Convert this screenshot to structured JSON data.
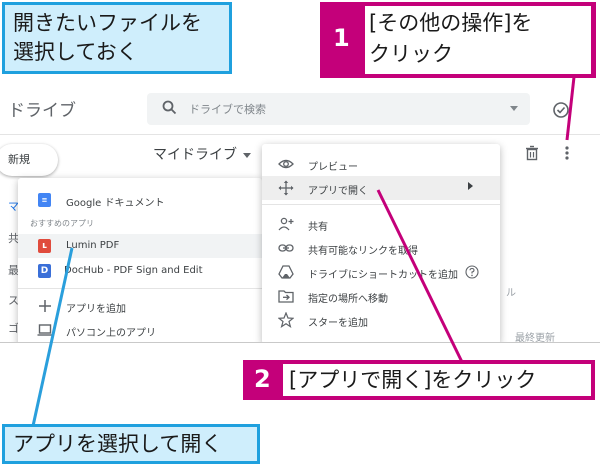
{
  "callouts": {
    "select_file": {
      "line1": "開きたいファイルを",
      "line2": "選択しておく"
    },
    "step1": {
      "number": "1",
      "line1": "[その他の操作]を",
      "line2": "クリック"
    },
    "step2": {
      "number": "2",
      "text": "[アプリで開く]をクリック"
    },
    "select_app": {
      "text": "アプリを選択して開く"
    }
  },
  "drive": {
    "title": "ドライブ",
    "search_placeholder": "ドライブで検索",
    "new_button": "新規",
    "breadcrumb": "マイドライブ"
  },
  "sidebar_peek": [
    "マ",
    "共",
    "最",
    "ス",
    "ゴ"
  ],
  "background_peek": {
    "ru": "ル",
    "last_modified": "最終更新"
  },
  "apps_menu": {
    "items_top": [
      {
        "label": "Google ドキュメント",
        "icon": "google-docs-icon"
      }
    ],
    "suggested_heading": "おすすめのアプリ",
    "suggested": [
      {
        "label": "Lumin PDF",
        "icon": "lumin-pdf-icon",
        "color": "#e04b3c",
        "selected": true
      },
      {
        "label": "DocHub - PDF Sign and Edit",
        "icon": "dochub-icon",
        "color": "#3a6fd8"
      }
    ],
    "actions": [
      {
        "label": "アプリを追加",
        "icon": "plus-icon"
      },
      {
        "label": "パソコン上のアプリ",
        "icon": "laptop-icon"
      }
    ]
  },
  "context_menu": {
    "items": [
      {
        "label": "プレビュー",
        "icon": "eye-icon"
      },
      {
        "label": "アプリで開く",
        "icon": "move-arrows-icon",
        "highlighted": true,
        "submenu": true
      },
      {
        "label": "共有",
        "icon": "person-add-icon"
      },
      {
        "label": "共有可能なリンクを取得",
        "icon": "link-icon"
      },
      {
        "label": "ドライブにショートカットを追加",
        "icon": "drive-shortcut-icon",
        "help": true
      },
      {
        "label": "指定の場所へ移動",
        "icon": "folder-move-icon"
      },
      {
        "label": "スターを追加",
        "icon": "star-icon"
      }
    ]
  },
  "colors": {
    "callout_blue": "#1fa0de",
    "callout_magenta": "#c4007a",
    "leader_blue": "#2a9fdc"
  }
}
